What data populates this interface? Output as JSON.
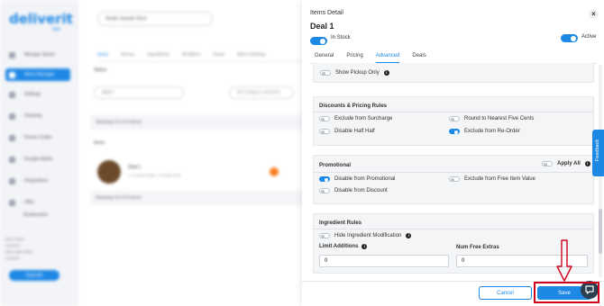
{
  "background": {
    "logo": "deliverit",
    "logo_sub": "labs",
    "sidebar_items": [
      "Manage Stores",
      "Menu Manager",
      "Settings",
      "Ordering",
      "Promo Codes",
      "Google Admin",
      "Integrations",
      "Offer",
      "Restaurants"
    ],
    "sidebar_footer": [
      "Who Owner",
      "12:00:00",
      "Who Latest Stats",
      "12:00:00"
    ],
    "sidebar_button": "Upgrade",
    "store_select": "Studio Sample Store",
    "tabs": [
      "Items",
      "Menus",
      "Ingredients",
      "Modifiers",
      "Deals",
      "Menu Settings"
    ],
    "status_label": "Status",
    "search_value": "deal 1",
    "filter_placeholder": "All Category selection",
    "showing_1": "Showing 0-0 of 0 items",
    "section_label": "Items",
    "item_title": "Deal 1",
    "item_sub": "1 x Lemon Soda, 1 x Small Pizza",
    "showing_2": "Showing 0-0 of 0 items"
  },
  "drawer": {
    "label": "Items Detail",
    "close_glyph": "×",
    "title": "Deal 1",
    "in_stock_label": "In Stock",
    "in_stock_on": true,
    "active_label": "Active",
    "active_on": true,
    "tabs": [
      "General",
      "Pricing",
      "Advanced",
      "Deals"
    ],
    "selected_tab": "Advanced",
    "show_pickup_label": "Show Pickup Only",
    "discounts": {
      "title": "Discounts & Pricing Rules",
      "options": [
        {
          "label": "Exclude from Surcharge",
          "on": false
        },
        {
          "label": "Round to Nearest Five Cents",
          "on": false
        },
        {
          "label": "Disable Half Half",
          "on": false
        },
        {
          "label": "Exclude from Re-Order",
          "on": true
        }
      ]
    },
    "promotional": {
      "title": "Promotional",
      "apply_all_label": "Apply All",
      "options": [
        {
          "label": "Disable from Promotional",
          "on": true
        },
        {
          "label": "Exclude from Free Item Value",
          "on": false
        },
        {
          "label": "Disable from Discount",
          "on": false
        }
      ]
    },
    "ingredient_rules": {
      "title": "Ingredient Rules",
      "hide_modification_label": "Hide Ingredient Modification",
      "limit_additions_label": "Limit Additions",
      "limit_additions_value": "0",
      "num_free_extras_label": "Num Free Extras",
      "num_free_extras_value": "0"
    },
    "cancel_label": "Cancel",
    "save_label": "Save"
  },
  "feedback_label": "Feedback",
  "info_glyph": "i",
  "colors": {
    "accent": "#1e88e5",
    "highlight": "#d0021b",
    "card_bg": "#f4f5f7"
  }
}
